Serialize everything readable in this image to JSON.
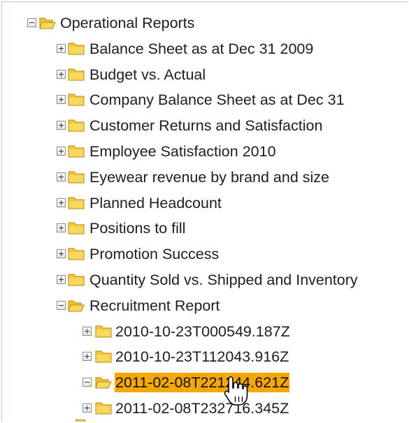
{
  "tree": {
    "root": {
      "label": "Operational Reports",
      "expanded": true
    },
    "items": [
      {
        "label": "Balance Sheet as at Dec 31 2009",
        "expanded": false
      },
      {
        "label": "Budget vs. Actual",
        "expanded": false
      },
      {
        "label": "Company Balance Sheet as at Dec 31",
        "expanded": false
      },
      {
        "label": "Customer Returns and Satisfaction",
        "expanded": false
      },
      {
        "label": "Employee Satisfaction 2010",
        "expanded": false
      },
      {
        "label": "Eyewear revenue by brand and size",
        "expanded": false
      },
      {
        "label": "Planned Headcount",
        "expanded": false
      },
      {
        "label": "Positions to fill",
        "expanded": false
      },
      {
        "label": "Promotion Success",
        "expanded": false
      },
      {
        "label": "Quantity Sold vs. Shipped and Inventory",
        "expanded": false
      },
      {
        "label": "Recruitment Report",
        "expanded": true
      }
    ],
    "children": [
      {
        "label": "2010-10-23T000549.187Z",
        "expanded": false,
        "selected": false
      },
      {
        "label": "2010-10-23T112043.916Z",
        "expanded": false,
        "selected": false
      },
      {
        "label": "2011-02-08T221244.621Z",
        "expanded": true,
        "selected": true
      },
      {
        "label": "2011-02-08T232716.345Z",
        "expanded": false,
        "selected": false
      }
    ]
  },
  "icons": {
    "collapse": "minus-box-icon",
    "expand": "plus-box-icon",
    "folder_closed": "folder-icon",
    "folder_open": "folder-open-icon",
    "cursor": "hand-pointer-icon"
  },
  "colors": {
    "selection": "#f5a800",
    "folder": "#f2c230",
    "frame_border": "#b6c6d6"
  }
}
